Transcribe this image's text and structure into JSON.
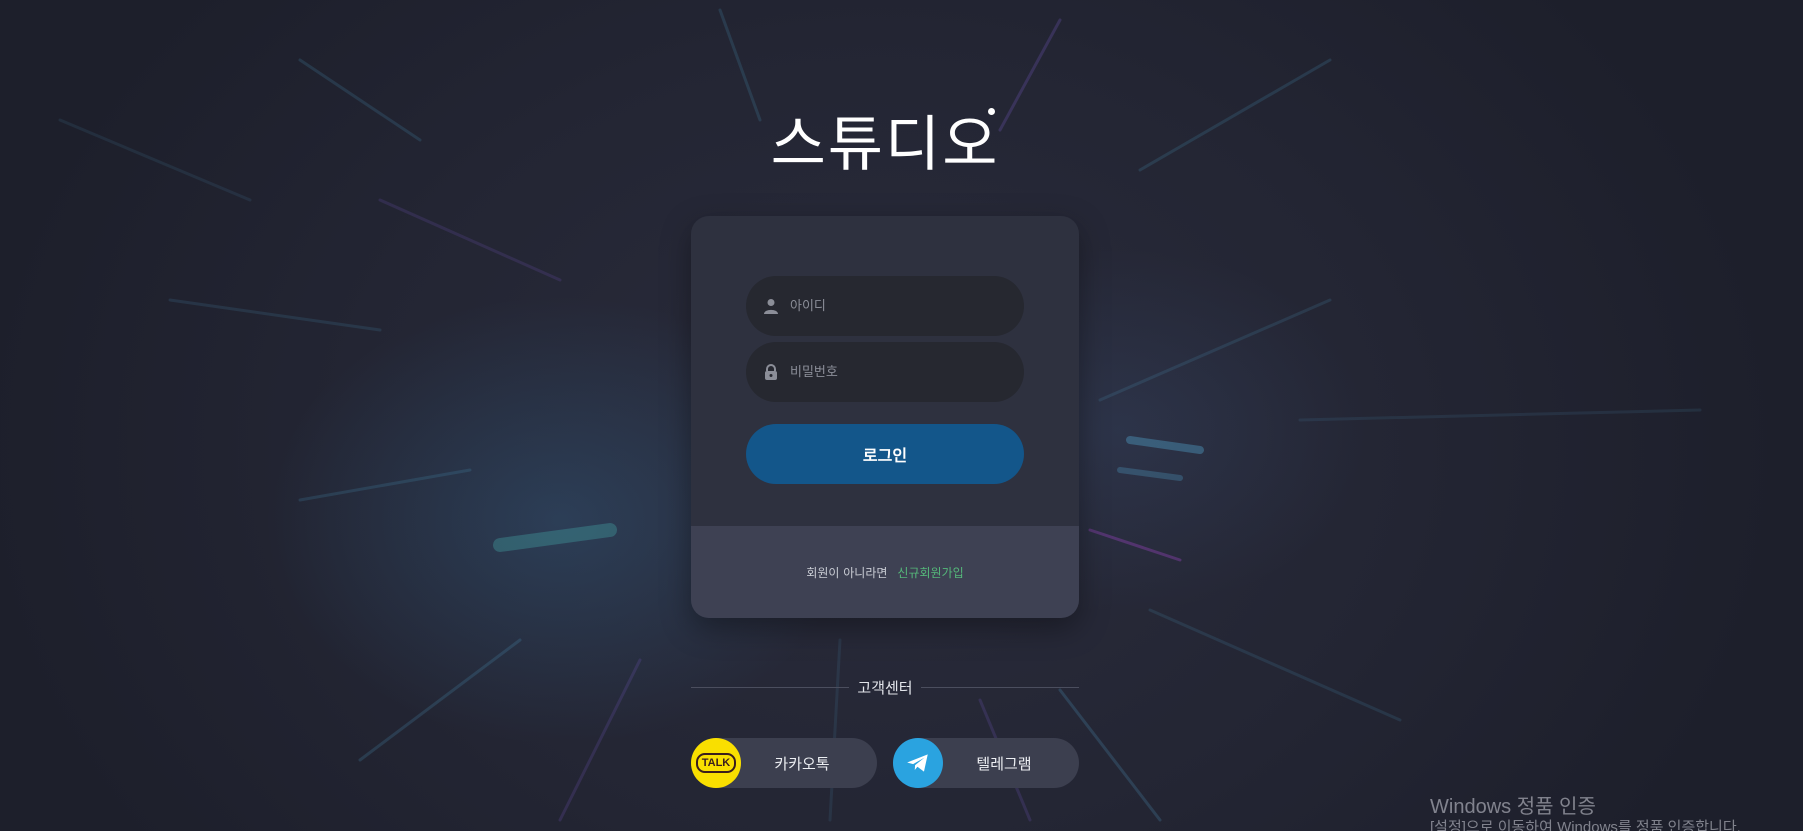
{
  "logo": {
    "text": "스튜디오"
  },
  "login_form": {
    "username_placeholder": "아이디",
    "password_placeholder": "비밀번호",
    "login_button": "로그인",
    "signup_prompt": "회원이 아니라면",
    "signup_link": "신규회원가입"
  },
  "support": {
    "title": "고객센터",
    "kakao_label": "카카오톡",
    "kakao_badge": "TALK",
    "telegram_label": "텔레그램"
  },
  "windows_notice": {
    "title": "Windows 정품 인증",
    "subtitle": "[설정]으로 이동하여 Windows를 정품 인증합니다."
  },
  "colors": {
    "background": "#262835",
    "card": "#2e313f",
    "card_footer": "#3e4153",
    "login_button": "#13568a",
    "signup_link": "#55b87a",
    "kakao": "#f9df00",
    "telegram": "#2aa3e0"
  },
  "icons": {
    "username": "user-icon",
    "password": "lock-icon",
    "kakao": "kakao-talk-icon",
    "telegram": "telegram-plane-icon"
  }
}
